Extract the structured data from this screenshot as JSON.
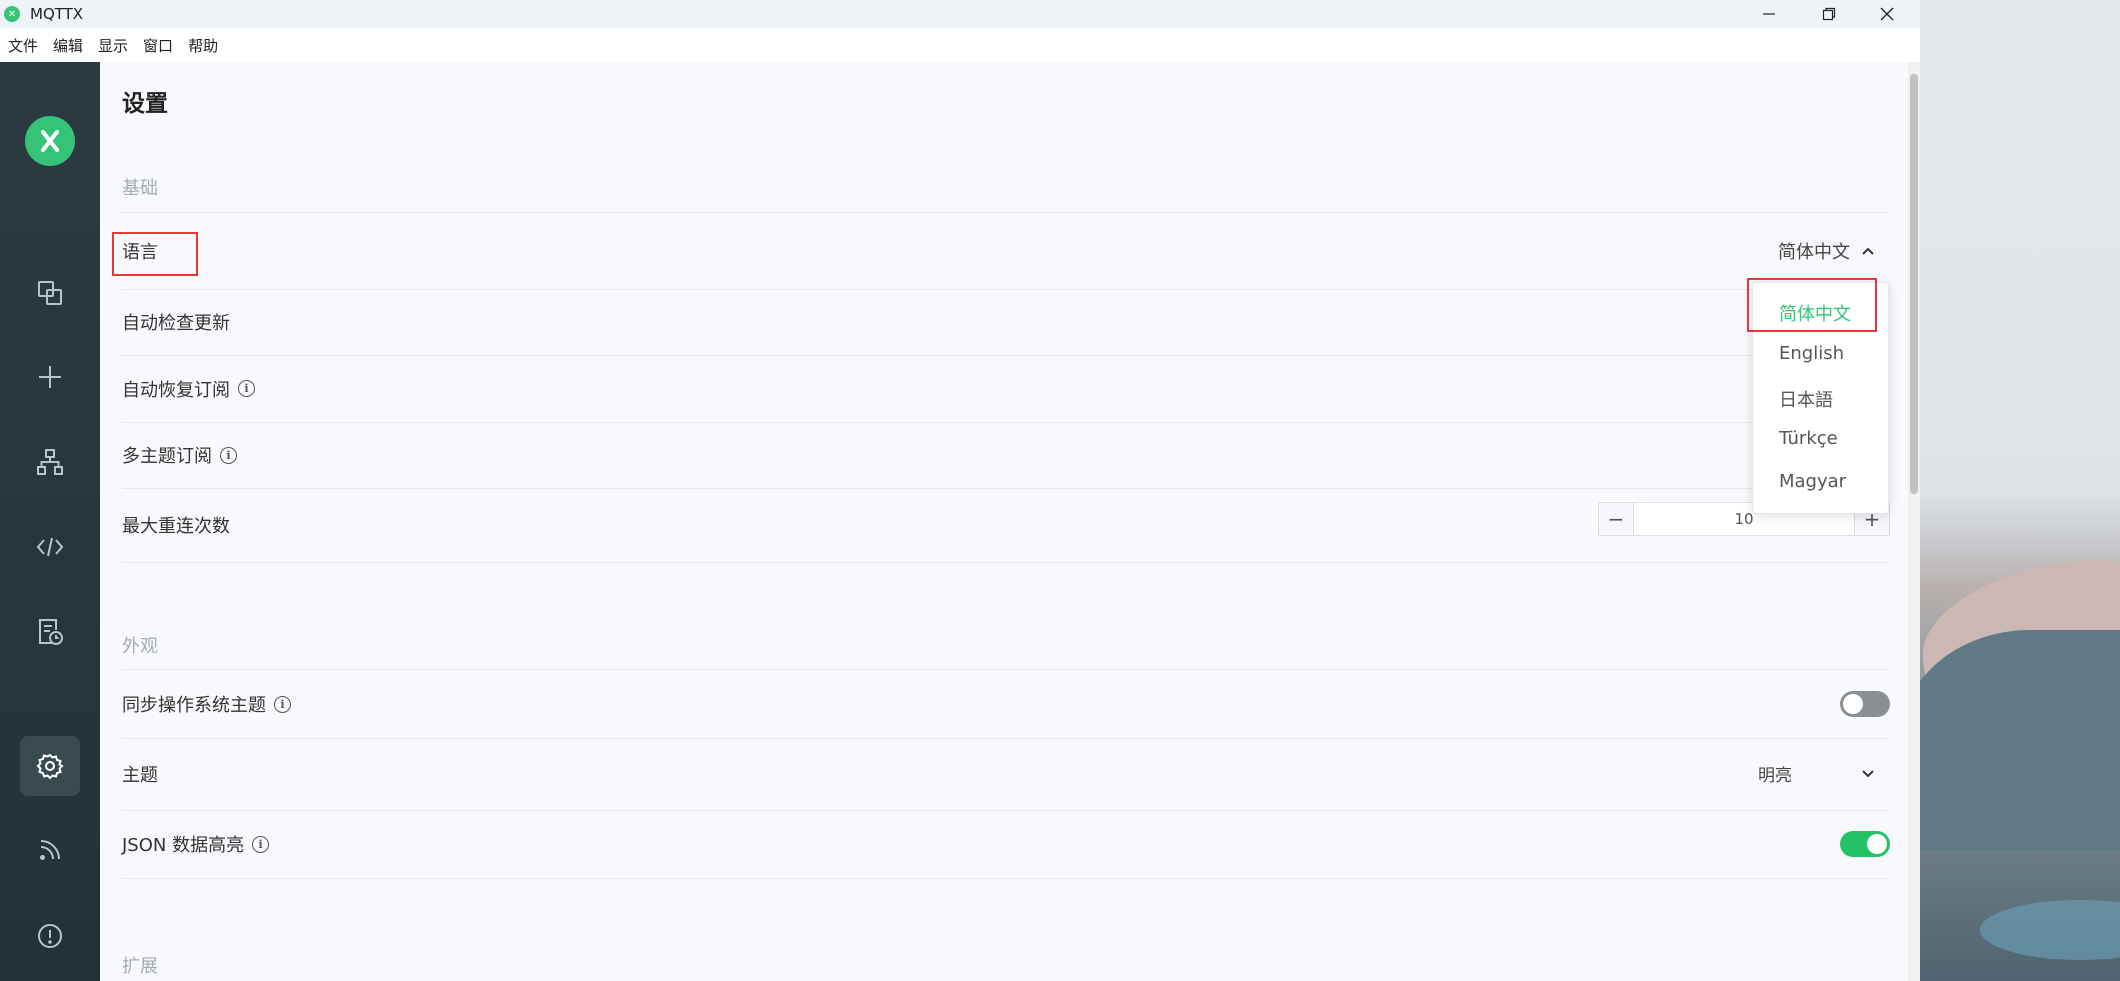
{
  "window": {
    "title": "MQTTX",
    "controls": {
      "minimize": "—",
      "maximize": "❐",
      "close": "✕"
    }
  },
  "menubar": [
    "文件",
    "编辑",
    "显示",
    "窗口",
    "帮助"
  ],
  "sidebar": {
    "items": [
      {
        "name": "connections",
        "icon": "connections-icon"
      },
      {
        "name": "new-connection",
        "icon": "plus-icon"
      },
      {
        "name": "topology",
        "icon": "network-icon"
      },
      {
        "name": "script",
        "icon": "code-icon"
      },
      {
        "name": "log",
        "icon": "log-icon"
      },
      {
        "name": "settings",
        "icon": "gear-icon",
        "active": true
      },
      {
        "name": "subscribe",
        "icon": "rss-icon"
      },
      {
        "name": "about",
        "icon": "info-icon"
      }
    ]
  },
  "settings": {
    "page_title": "设置",
    "basic": {
      "section_title": "基础",
      "language_label": "语言",
      "language_value": "简体中文",
      "auto_update_label": "自动检查更新",
      "auto_resub_label": "自动恢复订阅",
      "multi_topic_label": "多主题订阅",
      "max_reconnect_label": "最大重连次数",
      "max_reconnect_value": "10"
    },
    "appearance": {
      "section_title": "外观",
      "sync_os_theme_label": "同步操作系统主题",
      "sync_os_theme_on": false,
      "theme_label": "主题",
      "theme_value": "明亮",
      "json_highlight_label": "JSON 数据高亮",
      "json_highlight_on": true
    },
    "extension": {
      "section_title": "扩展"
    }
  },
  "language_dropdown": {
    "options": [
      "简体中文",
      "English",
      "日本語",
      "Türkçe",
      "Magyar"
    ],
    "selected": "简体中文"
  },
  "colors": {
    "accent": "#35c377",
    "sidebar_bg": "#2b3b41",
    "highlight_box": "#e53935",
    "toggle_off": "#8a8f94"
  }
}
